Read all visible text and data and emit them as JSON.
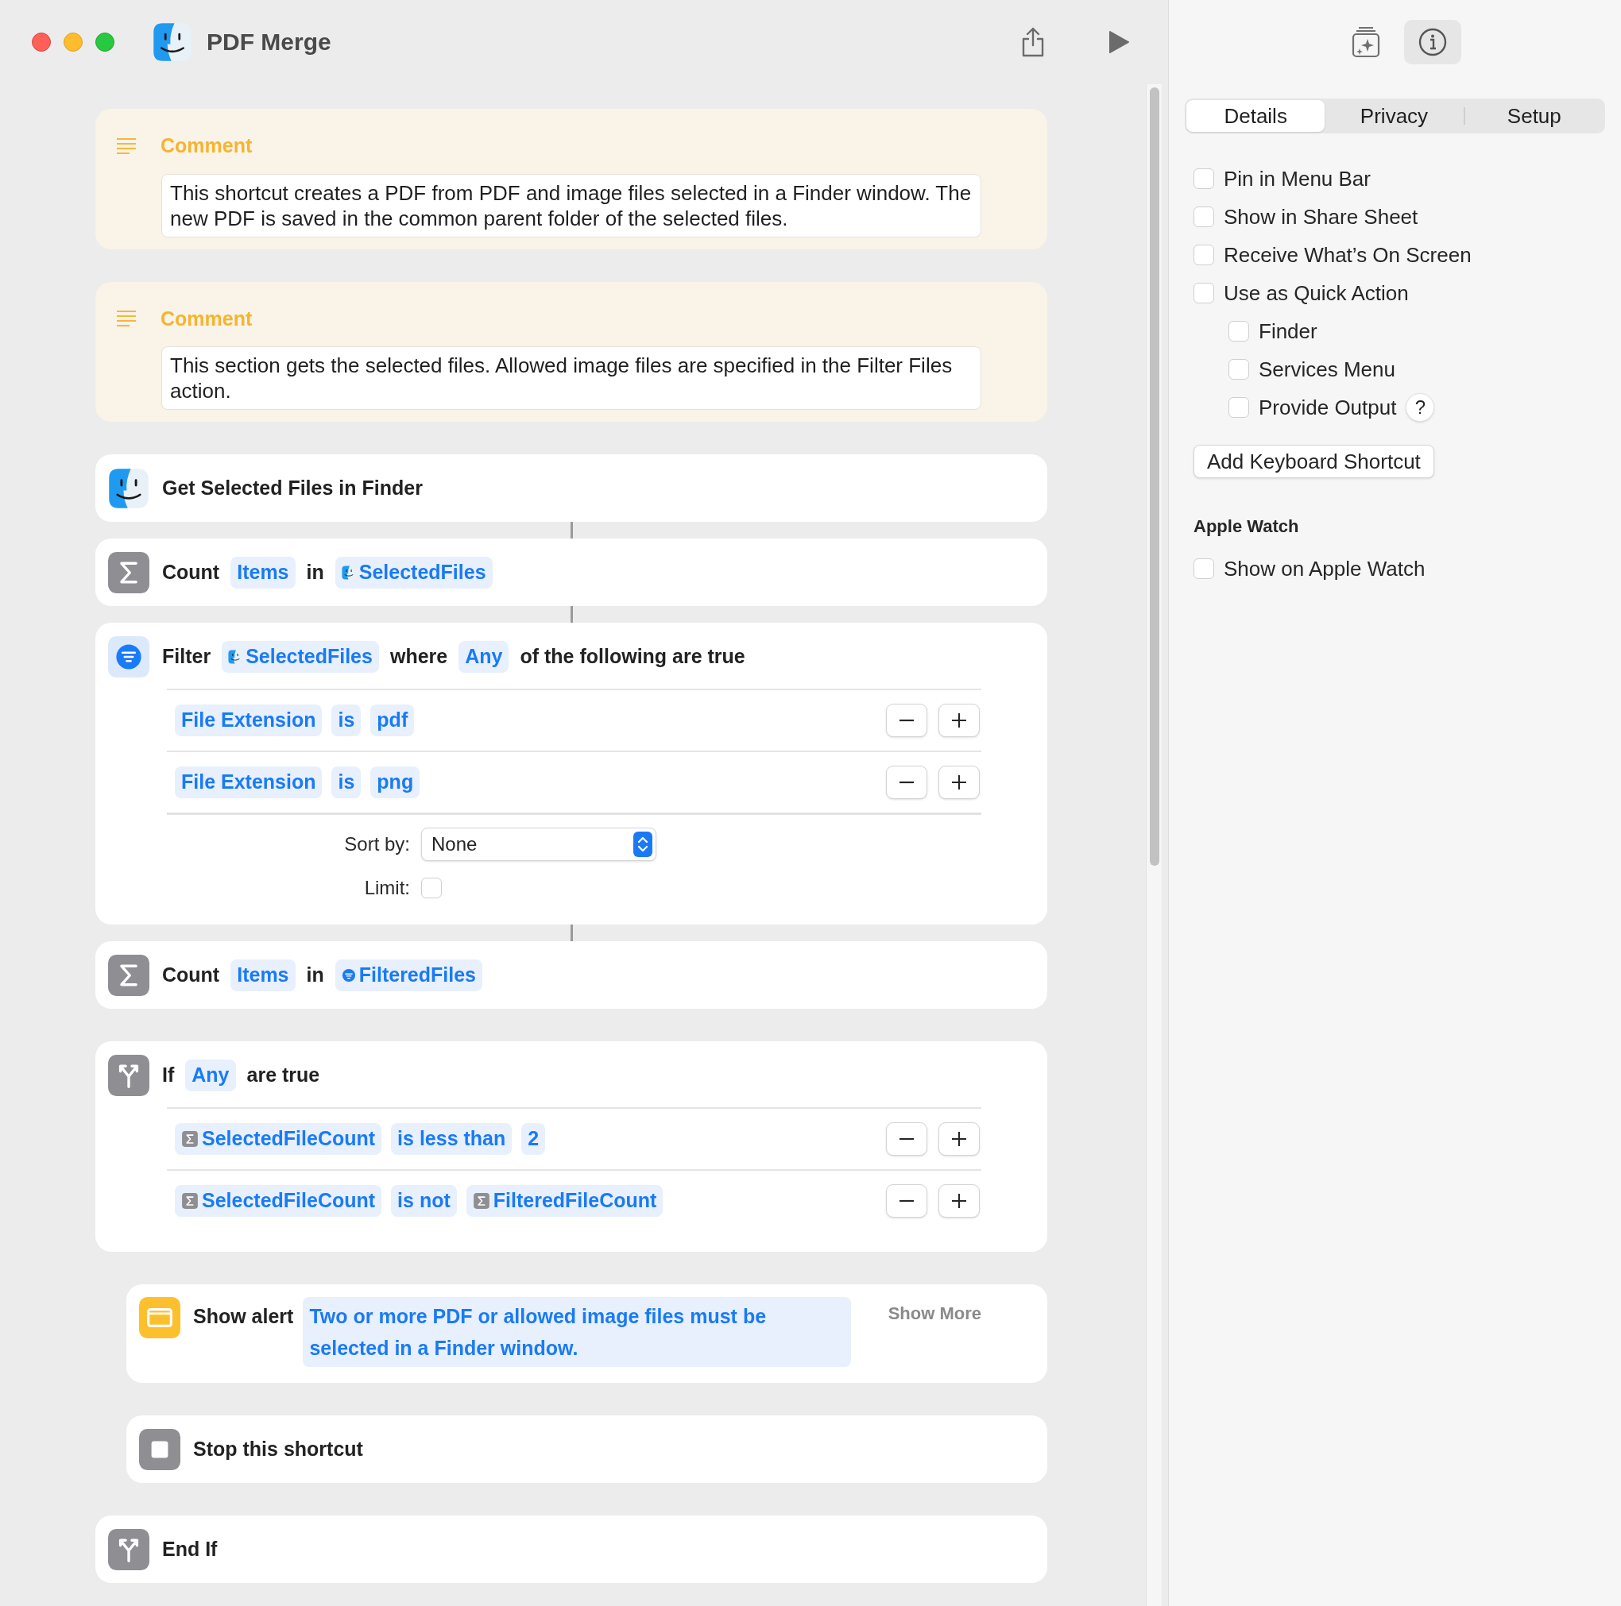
{
  "window": {
    "title": "PDF Merge"
  },
  "actions": [
    {
      "kind": "comment",
      "title": "Comment",
      "text": "This shortcut creates a PDF from PDF and image files selected in a Finder window. The new PDF is saved in the common parent folder of the selected files.",
      "linked_to_next": false
    },
    {
      "kind": "comment",
      "title": "Comment",
      "text": "This section gets the selected files. Allowed image files are specified in the Filter Files action.",
      "linked_to_next": false
    },
    {
      "kind": "get_files",
      "parts": [
        {
          "kind": "label",
          "text": "Get Selected Files in Finder"
        }
      ],
      "linked_to_next": true
    },
    {
      "kind": "count",
      "parts": [
        {
          "kind": "label",
          "text": "Count"
        },
        {
          "kind": "token",
          "text": "Items"
        },
        {
          "kind": "label",
          "text": "in"
        },
        {
          "kind": "files_variable",
          "text": "SelectedFiles"
        }
      ],
      "linked_to_next": true
    },
    {
      "kind": "filter",
      "parts": [
        {
          "kind": "label",
          "text": "Filter"
        },
        {
          "kind": "files_variable",
          "text": "SelectedFiles"
        },
        {
          "kind": "label",
          "text": "where"
        },
        {
          "kind": "token",
          "text": "Any"
        },
        {
          "kind": "label",
          "text": "of the following are true"
        }
      ],
      "conditions": [
        {
          "parts": [
            {
              "kind": "token",
              "text": "File Extension"
            },
            {
              "kind": "token",
              "text": "is"
            },
            {
              "kind": "token",
              "text": "pdf"
            }
          ]
        },
        {
          "parts": [
            {
              "kind": "token",
              "text": "File Extension"
            },
            {
              "kind": "token",
              "text": "is"
            },
            {
              "kind": "token",
              "text": "png"
            }
          ]
        }
      ],
      "sort_label": "Sort by:",
      "sort_value": "None",
      "limit_label": "Limit:",
      "limit_checked": false,
      "linked_to_next": true
    },
    {
      "kind": "count",
      "parts": [
        {
          "kind": "label",
          "text": "Count"
        },
        {
          "kind": "token",
          "text": "Items"
        },
        {
          "kind": "label",
          "text": "in"
        },
        {
          "kind": "filtered_variable",
          "text": "FilteredFiles"
        }
      ],
      "linked_to_next": false
    },
    {
      "kind": "if",
      "parts": [
        {
          "kind": "label",
          "text": "If"
        },
        {
          "kind": "token",
          "text": "Any"
        },
        {
          "kind": "label",
          "text": "are true"
        }
      ],
      "conditions": [
        {
          "parts": [
            {
              "kind": "count_variable",
              "text": "SelectedFileCount"
            },
            {
              "kind": "token",
              "text": "is less than"
            },
            {
              "kind": "token",
              "text": "2"
            }
          ]
        },
        {
          "parts": [
            {
              "kind": "count_variable",
              "text": "SelectedFileCount"
            },
            {
              "kind": "token",
              "text": "is not"
            },
            {
              "kind": "count_variable",
              "text": "FilteredFileCount"
            }
          ]
        }
      ],
      "linked_to_next": false,
      "children": [
        {
          "kind": "alert",
          "parts": [
            {
              "kind": "label",
              "text": "Show alert"
            },
            {
              "kind": "token",
              "text": "Two or more PDF or allowed image files must be selected in a Finder window."
            }
          ],
          "more": "Show More",
          "linked_to_next": false
        },
        {
          "kind": "stop",
          "parts": [
            {
              "kind": "label",
              "text": "Stop this shortcut"
            }
          ],
          "linked_to_next": false
        }
      ]
    },
    {
      "kind": "end_if",
      "parts": [
        {
          "kind": "label",
          "text": "End If"
        }
      ],
      "linked_to_next": false
    }
  ],
  "inspector": {
    "toolbar": [
      {
        "kind": "library",
        "selected": false
      },
      {
        "kind": "info",
        "selected": true
      }
    ],
    "tabs": [
      {
        "label": "Details",
        "selected": true
      },
      {
        "label": "Privacy",
        "selected": false
      },
      {
        "label": "Setup",
        "selected": false
      }
    ],
    "options": [
      {
        "label": "Pin in Menu Bar",
        "checked": false
      },
      {
        "label": "Show in Share Sheet",
        "checked": false
      },
      {
        "label": "Receive What’s On Screen",
        "checked": false
      },
      {
        "label": "Use as Quick Action",
        "checked": false,
        "children": [
          {
            "label": "Finder",
            "checked": false
          },
          {
            "label": "Services Menu",
            "checked": false
          },
          {
            "label": "Provide Output",
            "checked": false,
            "help": "?"
          }
        ]
      }
    ],
    "keyboard_shortcut_button": "Add Keyboard Shortcut",
    "sections": [
      {
        "title": "Apple Watch",
        "options": [
          {
            "label": "Show on Apple Watch",
            "checked": false
          }
        ]
      }
    ]
  }
}
